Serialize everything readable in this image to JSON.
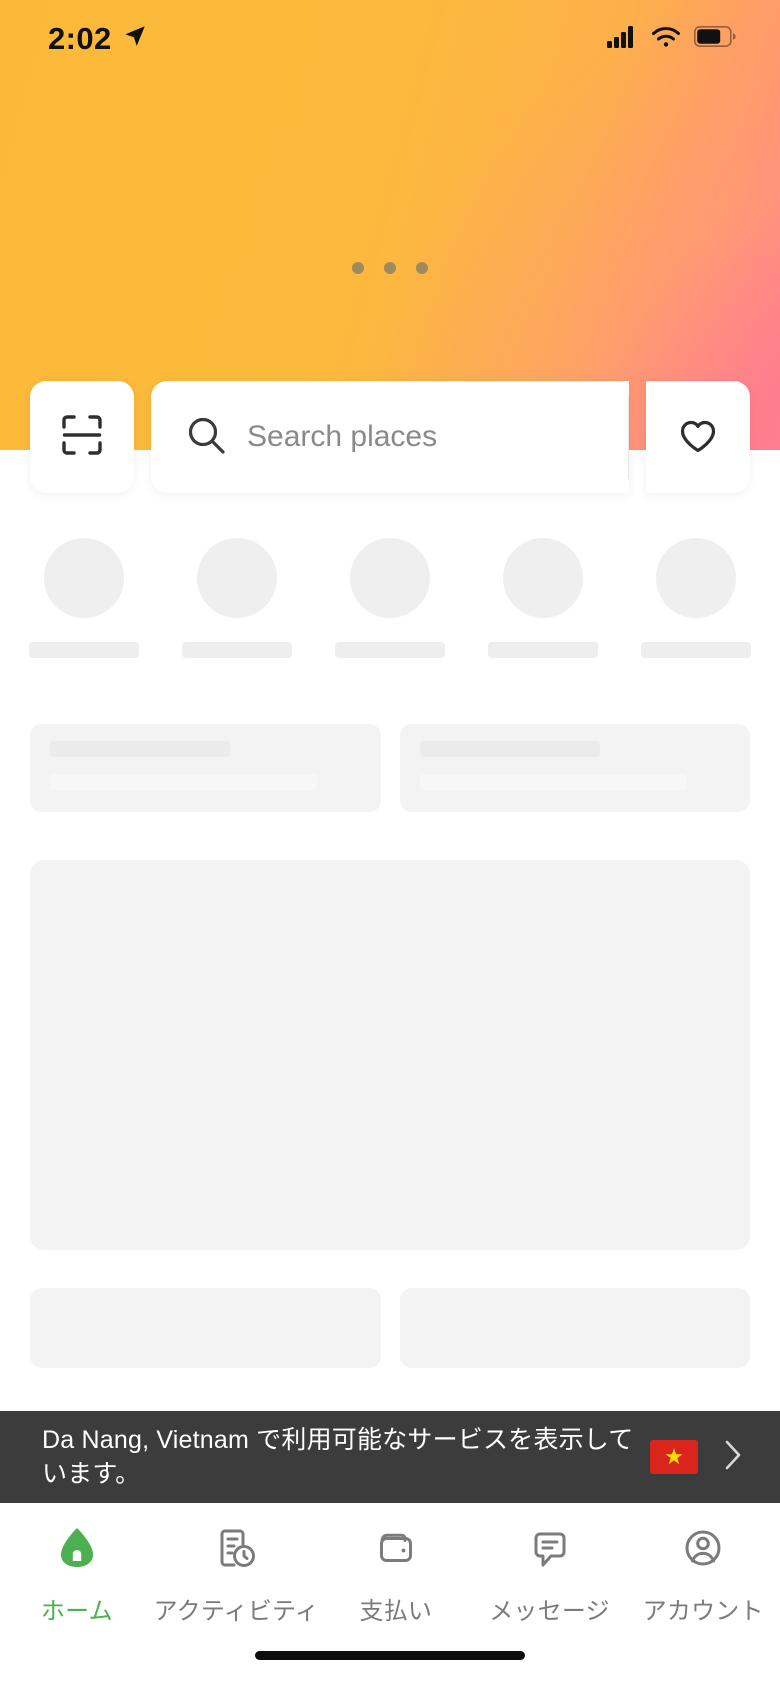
{
  "status_bar": {
    "time": "2:02",
    "location_icon": "location-arrow-icon",
    "cellular_icon": "cellular-bars-icon",
    "wifi_icon": "wifi-icon",
    "battery_icon": "battery-icon"
  },
  "hero": {
    "loading_dots": 3,
    "gradient_start": "#fcb939",
    "gradient_end": "#ff8090",
    "dot_color": "#9c8660"
  },
  "search": {
    "scan_icon": "scan-qr-icon",
    "search_icon": "magnifier-icon",
    "placeholder": "Search places",
    "value": "",
    "favorite_icon": "heart-outline-icon"
  },
  "skeleton": {
    "quick_action_count": 5,
    "card_count": 2,
    "bottom_card_count": 2,
    "shade": "#eeeeee"
  },
  "banner": {
    "text": "Da Nang, Vietnam で利用可能なサービスを表示しています。",
    "country_code": "VN",
    "flag_icon": "vietnam-flag-icon",
    "flag_color": "#da251d",
    "star_color": "#ffdd00",
    "chevron_icon": "chevron-right-icon",
    "background": "#3c3c3c"
  },
  "tabbar": {
    "active_color": "#4caf50",
    "inactive_color": "#7b7b7b",
    "items": [
      {
        "label": "ホーム",
        "icon": "home-icon",
        "active": true
      },
      {
        "label": "アクティビティ",
        "icon": "activity-icon",
        "active": false
      },
      {
        "label": "支払い",
        "icon": "wallet-icon",
        "active": false
      },
      {
        "label": "メッセージ",
        "icon": "message-icon",
        "active": false
      },
      {
        "label": "アカウント",
        "icon": "account-icon",
        "active": false
      }
    ]
  }
}
